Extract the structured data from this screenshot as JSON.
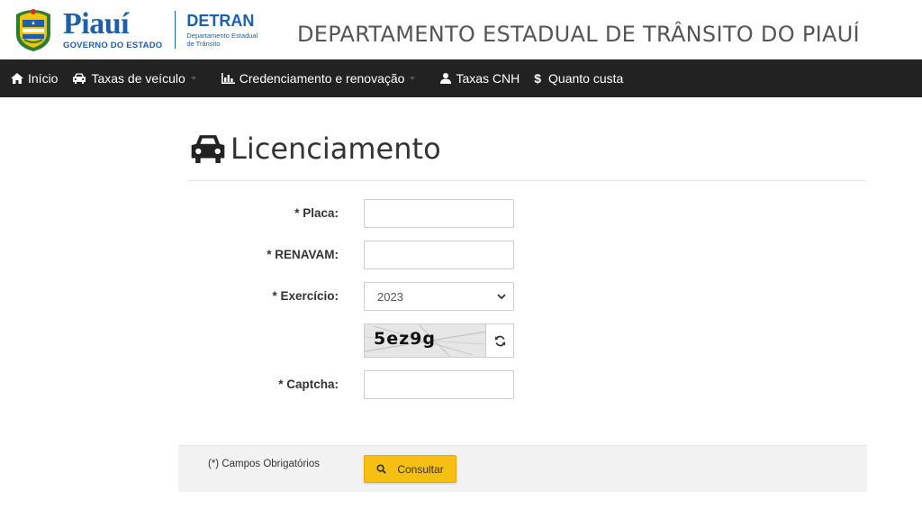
{
  "header": {
    "state_name": "Piauí",
    "state_subtitle": "GOVERNO DO ESTADO",
    "agency_name": "DETRAN",
    "agency_subtitle": "Departamento Estadual de Trânsito",
    "department_title": "DEPARTAMENTO ESTADUAL DE TRÂNSITO DO PIAUÍ"
  },
  "nav": {
    "items": [
      {
        "label": "Início",
        "icon": "home-icon",
        "has_dropdown": false
      },
      {
        "label": "Taxas de veículo",
        "icon": "car-icon",
        "has_dropdown": true
      },
      {
        "label": "Credenciamento e renovação",
        "icon": "chart-icon",
        "has_dropdown": true
      },
      {
        "label": "Taxas CNH",
        "icon": "user-icon",
        "has_dropdown": false
      },
      {
        "label": "Quanto custa",
        "icon": "dollar-icon",
        "has_dropdown": false
      }
    ]
  },
  "page": {
    "title": "Licenciamento",
    "title_icon": "car-icon"
  },
  "form": {
    "placa_label": "* Placa:",
    "placa_value": "",
    "renavam_label": "* RENAVAM:",
    "renavam_value": "",
    "exercicio_label": "* Exercício:",
    "exercicio_selected": "2023",
    "captcha_text": "5ez9g",
    "captcha_label": "* Captcha:",
    "captcha_value": ""
  },
  "footer": {
    "required_note": "(*) Campos Obrigatórios",
    "submit_label": "Consultar"
  },
  "colors": {
    "brand_blue": "#1f5fa8",
    "nav_bg": "#222222",
    "button_yellow": "#f6c012"
  }
}
